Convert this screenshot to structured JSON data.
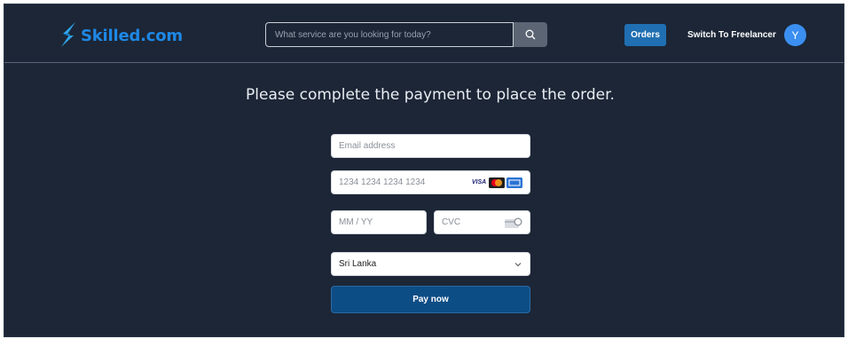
{
  "header": {
    "logo_text": "Skilled.com",
    "search_placeholder": "What service are you looking for today?",
    "search_icon": "search-icon",
    "orders_label": "Orders",
    "switch_label": "Switch To Freelancer",
    "avatar_initial": "Y",
    "colors": {
      "brand": "#1e88e5",
      "orders_bg": "#1f6fb2",
      "avatar_bg": "#3b8ff0",
      "background": "#1c2636"
    }
  },
  "payment": {
    "heading": "Please complete the payment to place the order.",
    "email_placeholder": "Email address",
    "card_placeholder": "1234 1234 1234 1234",
    "card_brands": [
      "visa",
      "mastercard",
      "amex"
    ],
    "visa_text": "VISA",
    "expiry_placeholder": "MM / YY",
    "cvc_placeholder": "CVC",
    "country_value": "Sri Lanka",
    "pay_label": "Pay now",
    "colors": {
      "pay_button": "#0d4d85"
    }
  }
}
